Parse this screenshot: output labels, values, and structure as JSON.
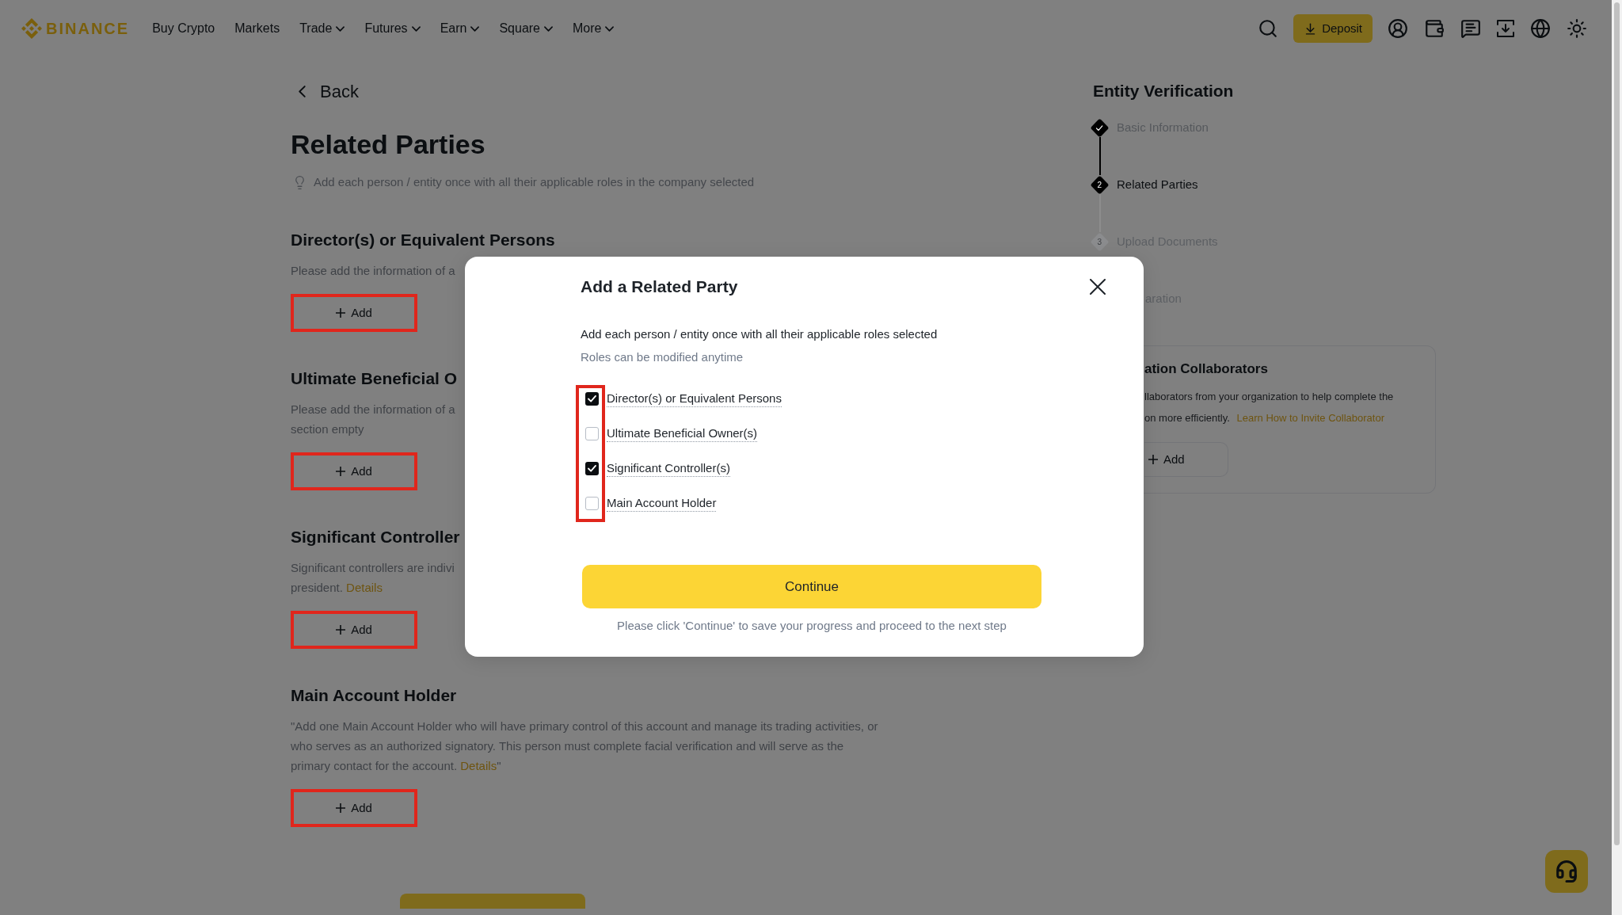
{
  "nav": {
    "logo": "BINANCE",
    "items": [
      {
        "label": "Buy Crypto",
        "dropdown": false
      },
      {
        "label": "Markets",
        "dropdown": false
      },
      {
        "label": "Trade",
        "dropdown": true
      },
      {
        "label": "Futures",
        "dropdown": true
      },
      {
        "label": "Earn",
        "dropdown": true
      },
      {
        "label": "Square",
        "dropdown": true
      },
      {
        "label": "More",
        "dropdown": true
      }
    ],
    "deposit_button": "Deposit"
  },
  "page": {
    "back": "Back",
    "title": "Related Parties",
    "hint": "Add each person / entity once with all their applicable roles in the company selected",
    "sections": [
      {
        "title": "Director(s) or Equivalent Persons",
        "description_lines": [
          "Please add the information of a"
        ],
        "add_button": "Add",
        "highlighted": true
      },
      {
        "title": "Ultimate Beneficial O",
        "description_lines": [
          "Please add the information of a",
          "section empty"
        ],
        "add_button": "Add",
        "highlighted": true
      },
      {
        "title": "Significant Controller",
        "description_lines": [
          "Significant controllers are indivi",
          "president."
        ],
        "link": "Details",
        "add_button": "Add",
        "highlighted": true
      },
      {
        "title": "Main Account Holder",
        "description_lines": [
          "\"Add one Main Account Holder who will have primary control of this account and manage its trading activities, or",
          "who serves as an authorized signatory. This person must complete facial verification and will serve as the",
          "primary contact for the account."
        ],
        "link": "Details",
        "link_suffix": "\"",
        "add_button": "Add",
        "highlighted": true
      }
    ]
  },
  "verification": {
    "title": "Entity Verification",
    "steps": [
      {
        "label": "Basic Information",
        "completed": true,
        "selected": false,
        "covered": false
      },
      {
        "label": "Related Parties",
        "number": "2",
        "completed": false,
        "selected": true,
        "covered": false
      },
      {
        "label": "Upload Documents",
        "number": "3",
        "completed": false,
        "selected": false,
        "covered": false
      },
      {
        "label": "aration",
        "completed": false,
        "selected": false,
        "covered": true
      }
    ]
  },
  "collaborators": {
    "title": "ation Collaborators",
    "description_lines": [
      "llaborators from your organization to help complete the",
      "on more efficiently."
    ],
    "link": "Learn How to Invite Collaborator",
    "add_button": "Add"
  },
  "dialog": {
    "title": "Add a Related Party",
    "subtitle": "Add each person / entity once with all their applicable roles selected",
    "note": "Roles can be modified anytime",
    "roles_highlighted": true,
    "roles": [
      {
        "label": "Director(s) or Equivalent Persons",
        "checked": true
      },
      {
        "label": "Ultimate Beneficial Owner(s)",
        "checked": false
      },
      {
        "label": "Significant Controller(s)",
        "checked": true
      },
      {
        "label": "Main Account Holder",
        "checked": false
      }
    ],
    "continue_button": "Continue",
    "footer": "Please click 'Continue' to save your progress and proceed to the next step"
  }
}
